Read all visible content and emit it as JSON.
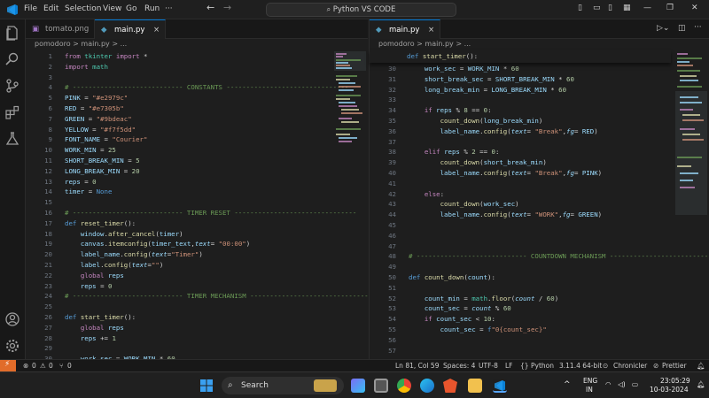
{
  "menu": [
    "File",
    "Edit",
    "Selection",
    "View",
    "Go",
    "Run"
  ],
  "command_center": "Python VS CODE",
  "left_pane": {
    "tabs": [
      {
        "label": "tomato.png",
        "icon": "image-icon"
      },
      {
        "label": "main.py",
        "icon": "python-icon"
      }
    ],
    "breadcrumb": "pomodoro > main.py > ...",
    "lines": [
      {
        "n": "1",
        "html": "<span class='kw'>from</span> <span class='bi'>tkinter</span> <span class='kw'>import</span> <span class='pl'>*</span>"
      },
      {
        "n": "2",
        "html": "<span class='kw'>import</span> <span class='bi'>math</span>"
      },
      {
        "n": "3",
        "html": ""
      },
      {
        "n": "4",
        "html": "<span class='cm'># ---------------------------- CONSTANTS -------------------------------</span>"
      },
      {
        "n": "5",
        "html": "<span class='var'>PINK</span> <span class='pl'>=</span> <span class='str'>\"#e2979c\"</span>"
      },
      {
        "n": "6",
        "html": "<span class='var'>RED</span> <span class='pl'>=</span> <span class='str'>\"#e7305b\"</span>"
      },
      {
        "n": "7",
        "html": "<span class='var'>GREEN</span> <span class='pl'>=</span> <span class='str'>\"#9bdeac\"</span>"
      },
      {
        "n": "8",
        "html": "<span class='var'>YELLOW</span> <span class='pl'>=</span> <span class='str'>\"#f7f5dd\"</span>"
      },
      {
        "n": "9",
        "html": "<span class='var'>FONT_NAME</span> <span class='pl'>=</span> <span class='str'>\"Courier\"</span>"
      },
      {
        "n": "10",
        "html": "<span class='var'>WORK_MIN</span> <span class='pl'>=</span> <span class='num'>25</span>"
      },
      {
        "n": "11",
        "html": "<span class='var'>SHORT_BREAK_MIN</span> <span class='pl'>=</span> <span class='num'>5</span>"
      },
      {
        "n": "12",
        "html": "<span class='var'>LONG_BREAK_MIN</span> <span class='pl'>=</span> <span class='num'>20</span>"
      },
      {
        "n": "13",
        "html": "<span class='var'>reps</span> <span class='pl'>=</span> <span class='num'>0</span>"
      },
      {
        "n": "14",
        "html": "<span class='var'>timer</span> <span class='pl'>=</span> <span class='blue'>None</span>"
      },
      {
        "n": "15",
        "html": ""
      },
      {
        "n": "16",
        "html": "<span class='cm'># ---------------------------- TIMER RESET -------------------------------</span>"
      },
      {
        "n": "17",
        "html": "<span class='blue'>def</span> <span class='fn'>reset_timer</span><span class='pl'>():</span>"
      },
      {
        "n": "18",
        "html": "    <span class='var'>window</span><span class='pl'>.</span><span class='fn'>after_cancel</span><span class='pl'>(</span><span class='var'>timer</span><span class='pl'>)</span>"
      },
      {
        "n": "19",
        "html": "    <span class='var'>canvas</span><span class='pl'>.</span><span class='fn'>itemconfig</span><span class='pl'>(</span><span class='var'>timer_text</span><span class='pl'>,</span><span class='it'>text</span><span class='pl'>=</span> <span class='str'>\"00:00\"</span><span class='pl'>)</span>"
      },
      {
        "n": "20",
        "html": "    <span class='var'>label_name</span><span class='pl'>.</span><span class='fn'>config</span><span class='pl'>(</span><span class='it'>text</span><span class='pl'>=</span><span class='str'>\"Timer\"</span><span class='pl'>)</span>"
      },
      {
        "n": "21",
        "html": "    <span class='var'>label</span><span class='pl'>.</span><span class='fn'>config</span><span class='pl'>(</span><span class='it'>text</span><span class='pl'>=</span><span class='str'>\"\"</span><span class='pl'>)</span>"
      },
      {
        "n": "22",
        "html": "    <span class='kw'>global</span> <span class='var'>reps</span>"
      },
      {
        "n": "23",
        "html": "    <span class='var'>reps</span> <span class='pl'>=</span> <span class='num'>0</span>"
      },
      {
        "n": "24",
        "html": "<span class='cm'># ---------------------------- TIMER MECHANISM -------------------------------</span>"
      },
      {
        "n": "25",
        "html": ""
      },
      {
        "n": "26",
        "html": "<span class='blue'>def</span> <span class='fn'>start_timer</span><span class='pl'>():</span>"
      },
      {
        "n": "27",
        "html": "    <span class='kw'>global</span> <span class='var'>reps</span>"
      },
      {
        "n": "28",
        "html": "    <span class='var'>reps</span> <span class='pl'>+=</span> <span class='num'>1</span>"
      },
      {
        "n": "29",
        "html": ""
      },
      {
        "n": "30",
        "html": "    <span class='var'>work_sec</span> <span class='pl'>=</span> <span class='var'>WORK_MIN</span> <span class='pl'>*</span> <span class='num'>60</span>"
      }
    ]
  },
  "right_pane": {
    "tabs": [
      {
        "label": "main.py",
        "icon": "python-icon"
      }
    ],
    "breadcrumb": "pomodoro > main.py > ...",
    "sticky": "<span class='blue'>def</span> <span class='fn'>start_timer</span><span class='pl'>():</span>",
    "lines": [
      {
        "n": "30",
        "html": "    <span class='var'>work_sec</span> <span class='pl'>=</span> <span class='var'>WORK_MIN</span> <span class='pl'>*</span> <span class='num'>60</span>"
      },
      {
        "n": "31",
        "html": "    <span class='var'>short_break_sec</span> <span class='pl'>=</span> <span class='var'>SHORT_BREAK_MIN</span> <span class='pl'>*</span> <span class='num'>60</span>"
      },
      {
        "n": "32",
        "html": "    <span class='var'>long_break_min</span> <span class='pl'>=</span> <span class='var'>LONG_BREAK_MIN</span> <span class='pl'>*</span> <span class='num'>60</span>"
      },
      {
        "n": "33",
        "html": ""
      },
      {
        "n": "34",
        "html": "    <span class='kw'>if</span> <span class='var'>reps</span> <span class='pl'>%</span> <span class='num'>8</span> <span class='pl'>==</span> <span class='num'>0</span><span class='pl'>:</span>"
      },
      {
        "n": "35",
        "html": "        <span class='fn'>count_down</span><span class='pl'>(</span><span class='var'>long_break_min</span><span class='pl'>)</span>"
      },
      {
        "n": "36",
        "html": "        <span class='var'>label_name</span><span class='pl'>.</span><span class='fn'>config</span><span class='pl'>(</span><span class='it'>text</span><span class='pl'>=</span> <span class='str'>\"Break\"</span><span class='pl'>,</span><span class='it'>fg</span><span class='pl'>=</span> <span class='var'>RED</span><span class='pl'>)</span>"
      },
      {
        "n": "37",
        "html": ""
      },
      {
        "n": "38",
        "html": "    <span class='kw'>elif</span> <span class='var'>reps</span> <span class='pl'>%</span> <span class='num'>2</span> <span class='pl'>==</span> <span class='num'>0</span><span class='pl'>:</span>"
      },
      {
        "n": "39",
        "html": "        <span class='fn'>count_down</span><span class='pl'>(</span><span class='var'>short_break_min</span><span class='pl'>)</span>"
      },
      {
        "n": "40",
        "html": "        <span class='var'>label_name</span><span class='pl'>.</span><span class='fn'>config</span><span class='pl'>(</span><span class='it'>text</span><span class='pl'>=</span> <span class='str'>\"Break\"</span><span class='pl'>,</span><span class='it'>fg</span><span class='pl'>=</span> <span class='var'>PINK</span><span class='pl'>)</span>"
      },
      {
        "n": "41",
        "html": ""
      },
      {
        "n": "42",
        "html": "    <span class='kw'>else</span><span class='pl'>:</span>"
      },
      {
        "n": "43",
        "html": "        <span class='fn'>count_down</span><span class='pl'>(</span><span class='var'>work_sec</span><span class='pl'>)</span>"
      },
      {
        "n": "44",
        "html": "        <span class='var'>label_name</span><span class='pl'>.</span><span class='fn'>config</span><span class='pl'>(</span><span class='it'>text</span><span class='pl'>=</span> <span class='str'>\"WORK\"</span><span class='pl'>,</span><span class='it'>fg</span><span class='pl'>=</span> <span class='var'>GREEN</span><span class='pl'>)</span>"
      },
      {
        "n": "45",
        "html": ""
      },
      {
        "n": "46",
        "html": ""
      },
      {
        "n": "47",
        "html": ""
      },
      {
        "n": "48",
        "html": "<span class='cm'># ---------------------------- COUNTDOWN MECHANISM -------------------------------</span>"
      },
      {
        "n": "49",
        "html": ""
      },
      {
        "n": "50",
        "html": "<span class='blue'>def</span> <span class='fn'>count_down</span><span class='pl'>(</span><span class='var'>count</span><span class='pl'>):</span>"
      },
      {
        "n": "51",
        "html": ""
      },
      {
        "n": "52",
        "html": "    <span class='var'>count_min</span> <span class='pl'>=</span> <span class='bi'>math</span><span class='pl'>.</span><span class='fn'>floor</span><span class='pl'>(</span><span class='it'>count</span> <span class='pl'>/</span> <span class='num'>60</span><span class='pl'>)</span>"
      },
      {
        "n": "53",
        "html": "    <span class='var'>count_sec</span> <span class='pl'>=</span> <span class='it'>count</span> <span class='pl'>%</span> <span class='num'>60</span>"
      },
      {
        "n": "54",
        "html": "    <span class='kw'>if</span> <span class='var'>count_sec</span> <span class='pl'>&lt;</span> <span class='num'>10</span><span class='pl'>:</span>"
      },
      {
        "n": "55",
        "html": "        <span class='var'>count_sec</span> <span class='pl'>=</span> <span class='blue'>f</span><span class='str'>\"0{count_sec}\"</span>"
      },
      {
        "n": "56",
        "html": ""
      },
      {
        "n": "57",
        "html": ""
      }
    ]
  },
  "status": {
    "errors": "0",
    "warnings": "0",
    "ports": "0",
    "position": "Ln 81, Col 59",
    "spaces": "Spaces: 4",
    "encoding": "UTF-8",
    "eol": "LF",
    "language": "Python",
    "interpreter": "3.11.4 64-bit",
    "chronicler": "Chronicler",
    "prettier": "Prettier"
  },
  "taskbar": {
    "search": "Search",
    "lang1": "ENG",
    "lang2": "IN",
    "time": "23:05:29",
    "date": "10-03-2024"
  },
  "colors": {
    "accent": "#0078d4",
    "remote": "#e16c2a"
  }
}
